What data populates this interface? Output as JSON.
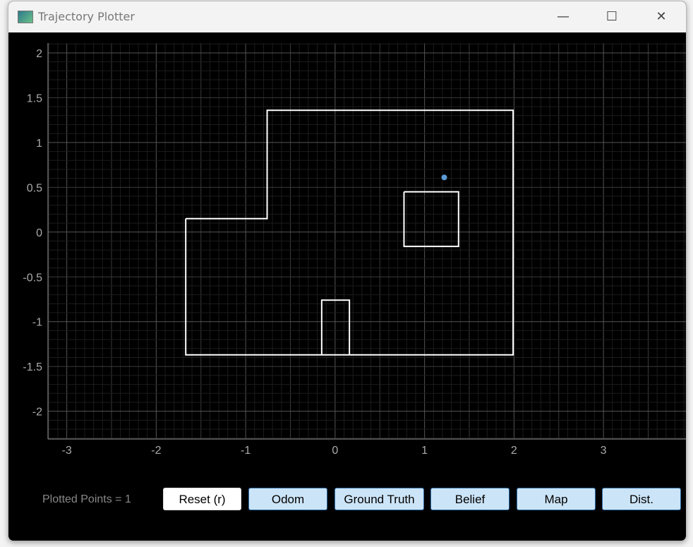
{
  "window": {
    "title": "Trajectory Plotter",
    "controls": [
      "minimize",
      "maximize",
      "close"
    ]
  },
  "chart_data": {
    "type": "line",
    "xlim": [
      -3.21,
      3.93
    ],
    "ylim": [
      -2.31,
      2.11
    ],
    "x_ticks": [
      -3,
      -2,
      -1,
      0,
      1,
      2,
      3
    ],
    "y_ticks": [
      2,
      1.5,
      1,
      0.5,
      0,
      -0.5,
      -1,
      -1.5,
      -2
    ],
    "grid": true,
    "background": "#000000",
    "map_color": "#ffffff",
    "point_color": "#5b9bd5",
    "map_polygons": [
      [
        [
          -1.67,
          0.15
        ],
        [
          -0.76,
          0.15
        ],
        [
          -0.76,
          1.36
        ],
        [
          1.99,
          1.36
        ],
        [
          1.99,
          -1.37
        ],
        [
          -1.67,
          -1.37
        ],
        [
          -1.67,
          0.15
        ]
      ],
      [
        [
          0.77,
          0.45
        ],
        [
          1.38,
          0.45
        ],
        [
          1.38,
          -0.16
        ],
        [
          0.77,
          -0.16
        ],
        [
          0.77,
          0.45
        ]
      ],
      [
        [
          -0.15,
          -1.37
        ],
        [
          -0.15,
          -0.76
        ],
        [
          0.16,
          -0.76
        ],
        [
          0.16,
          -1.37
        ]
      ]
    ],
    "points": [
      [
        1.22,
        0.61
      ]
    ]
  },
  "footer": {
    "plotted_points": "Plotted Points = 1",
    "buttons": [
      "Reset (r)",
      "Odom",
      "Ground Truth",
      "Belief",
      "Map",
      "Dist."
    ]
  }
}
